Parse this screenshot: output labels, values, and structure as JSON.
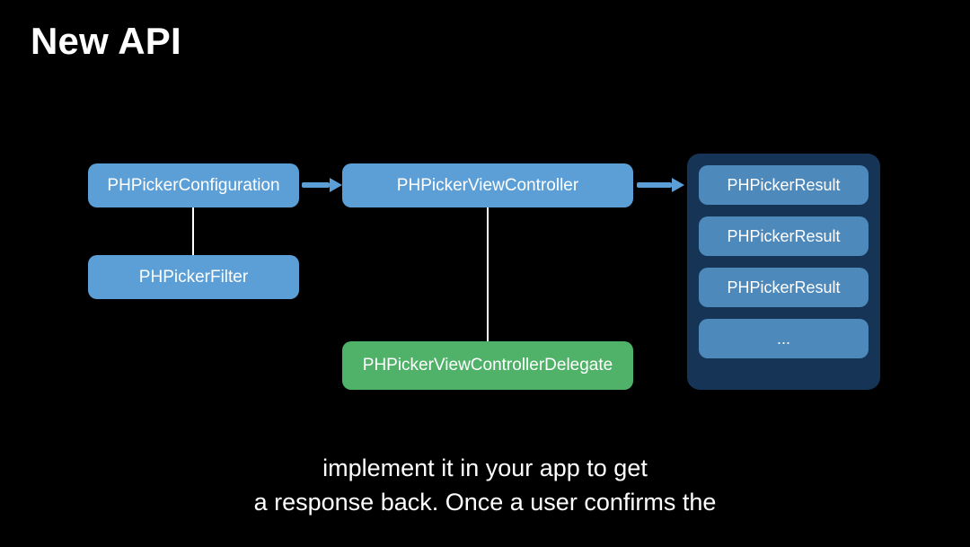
{
  "header": {
    "title": "New API"
  },
  "diagram": {
    "config_box": "PHPickerConfiguration",
    "filter_box": "PHPickerFilter",
    "controller_box": "PHPickerViewController",
    "delegate_box": "PHPickerViewControllerDelegate",
    "results": {
      "items": [
        "PHPickerResult",
        "PHPickerResult",
        "PHPickerResult",
        "..."
      ]
    }
  },
  "caption": {
    "line1": "implement it in your app to get",
    "line2": "a response back. Once a user confirms the"
  }
}
